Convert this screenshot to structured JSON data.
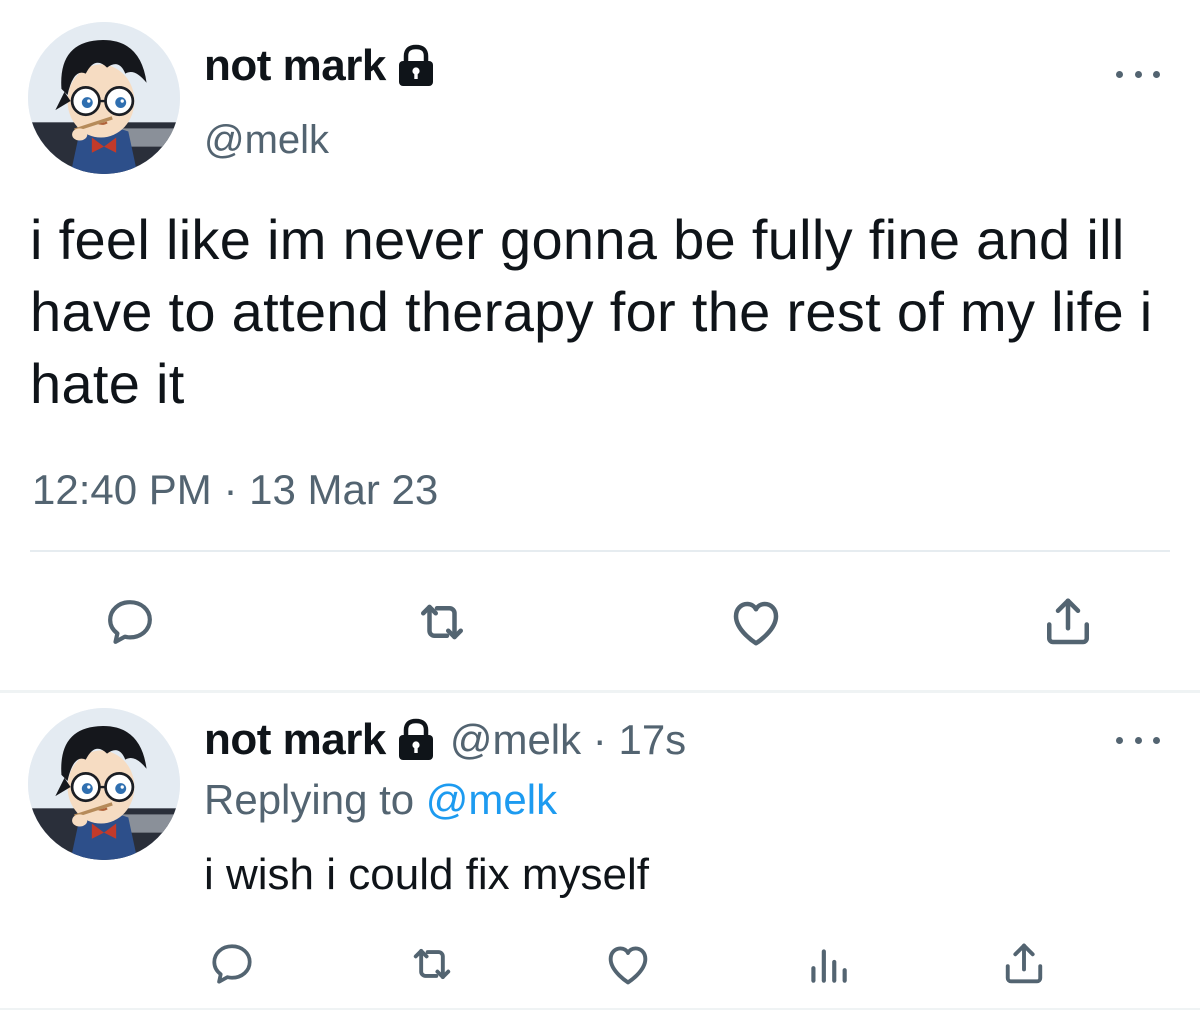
{
  "main_tweet": {
    "display_name": "not mark",
    "handle": "@melk",
    "text": "i feel like im never gonna be fully fine and ill have to attend therapy for the rest of my life i hate it",
    "timestamp": "12:40 PM · 13 Mar 23",
    "actions": [
      "reply-icon",
      "retweet-icon",
      "like-icon",
      "share-icon"
    ]
  },
  "reply_tweet": {
    "display_name": "not mark",
    "handle_time": "@melk · 17s",
    "replying_prefix": "Replying to",
    "replying_mention": "@melk",
    "text": "i wish i could fix myself",
    "actions": [
      "reply-icon",
      "retweet-icon",
      "like-icon",
      "views-icon",
      "share-icon"
    ]
  },
  "icons": {
    "lock": "lock-icon",
    "more": "more-options-icon"
  },
  "colors": {
    "text_primary": "#0f1419",
    "text_secondary": "#536471",
    "link": "#1d9bf0",
    "divider": "#eff3f4"
  }
}
